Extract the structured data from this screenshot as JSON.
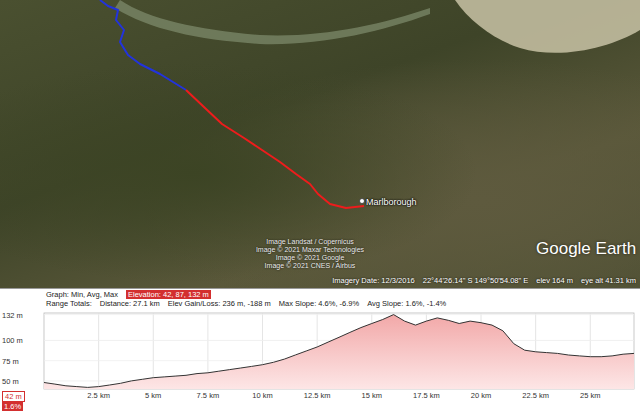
{
  "map": {
    "place_label": "Marlborough",
    "attribution": [
      "Image Landsat / Copernicus",
      "Image © 2021 Maxar Technologies",
      "Image © 2021 Google",
      "Image © 2021 CNES / Airbus"
    ],
    "logo": "Google Earth",
    "route": [
      {
        "name": "earlier",
        "color": "#2233dd"
      },
      {
        "name": "selected",
        "color": "#ee1c1c"
      }
    ]
  },
  "status_bar": {
    "imagery_date": "Imagery Date: 12/3/2016",
    "coordinates": "22°44'26.14\" S 149°50'54.08\" E",
    "elev": "elev 164 m",
    "eye_alt": "eye alt 41.31 km"
  },
  "profile": {
    "summary_label": "Graph: Min, Avg, Max",
    "summary_value": "Elevation: 42, 87, 132 m",
    "totals": [
      "Range Totals:",
      "Distance: 27.1 km",
      "Elev Gain/Loss: 236 m, -188 m",
      "Max Slope: 4.6%, -6.9%",
      "Avg Slope: 1.6%, -1.4%"
    ],
    "y_ticks": [
      {
        "label": "132 m",
        "m": 132
      },
      {
        "label": "100 m",
        "m": 100
      },
      {
        "label": "75 m",
        "m": 75
      },
      {
        "label": "50 m",
        "m": 50
      }
    ],
    "x_ticks": [
      {
        "label": "2.5 km",
        "km": 2.5
      },
      {
        "label": "5 km",
        "km": 5
      },
      {
        "label": "7.5 km",
        "km": 7.5
      },
      {
        "label": "10 km",
        "km": 10
      },
      {
        "label": "12.5 km",
        "km": 12.5
      },
      {
        "label": "15 km",
        "km": 15
      },
      {
        "label": "17.5 km",
        "km": 17.5
      },
      {
        "label": "20 km",
        "km": 20
      },
      {
        "label": "22.5 km",
        "km": 22.5
      },
      {
        "label": "25 km",
        "km": 25
      }
    ],
    "min_marker": "42 m",
    "slope_marker": "1.6%",
    "series": [
      {
        "name": "Elevation",
        "values": [
          48,
          46,
          44,
          43,
          42,
          43,
          45,
          47,
          50,
          52,
          54,
          55,
          56,
          57,
          59,
          60,
          62,
          64,
          66,
          68,
          70,
          73,
          77,
          82,
          87,
          92,
          98,
          104,
          110,
          116,
          121,
          126,
          132,
          124,
          119,
          124,
          128,
          125,
          121,
          124,
          122,
          119,
          112,
          96,
          88,
          86,
          85,
          84,
          82,
          81,
          80,
          80,
          81,
          83,
          84
        ]
      }
    ]
  }
}
